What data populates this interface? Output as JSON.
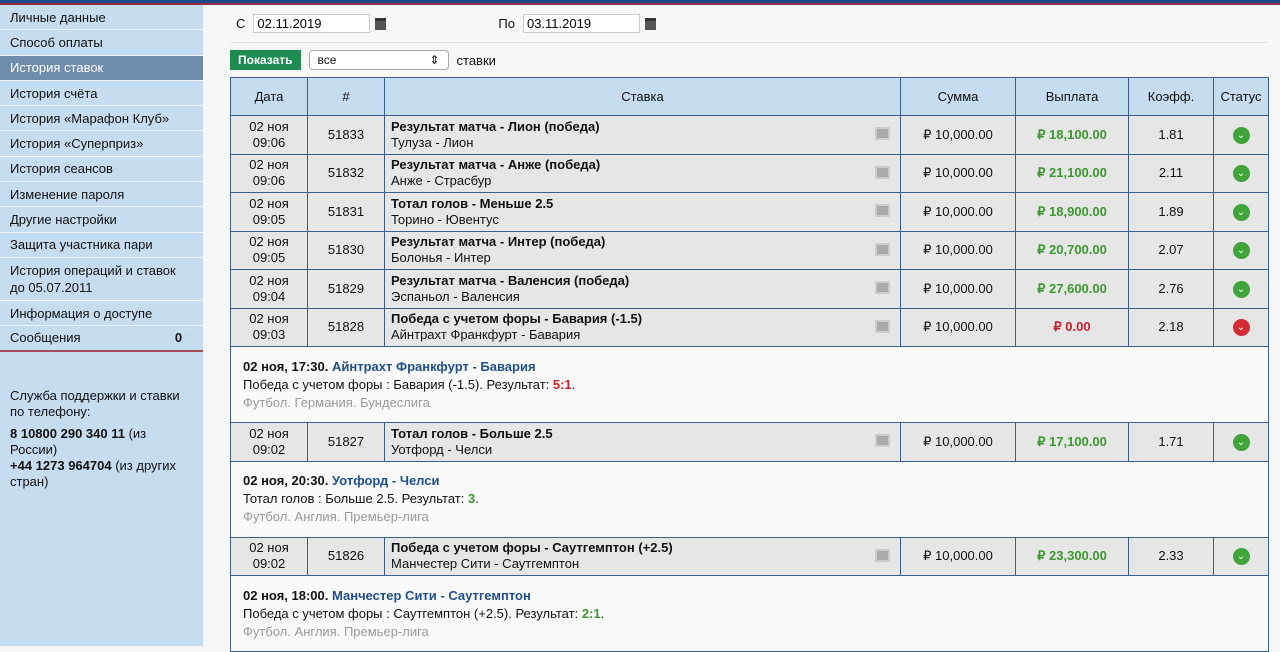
{
  "sidebar": {
    "items": [
      "Личные данные",
      "Способ оплаты",
      "История ставок",
      "История счёта",
      "История «Марафон Клуб»",
      "История «Суперприз»",
      "История сеансов",
      "Изменение пароля",
      "Другие настройки",
      "Защита участника пари",
      "История операций и ставок до 05.07.2011",
      "Информация о доступе",
      "Сообщения"
    ],
    "messages_read": "0",
    "messages_total": "/1",
    "support_title": "Служба поддержки и ставки по телефону:",
    "phone_ru": "8 10800 290 340 11",
    "phone_ru_note": " (из России)",
    "phone_intl": "+44 1273 964704",
    "phone_intl_note": " (из других стран)"
  },
  "filters": {
    "from_label": "С",
    "from": "02.11.2019",
    "to_label": "По",
    "to": "03.11.2019",
    "show": "Показать",
    "type": "все",
    "type_suffix": "ставки"
  },
  "table": {
    "headers": [
      "Дата",
      "#",
      "Ставка",
      "Сумма",
      "Выплата",
      "Коэфф.",
      "Статус"
    ],
    "rows": [
      {
        "date": "02 ноя",
        "time": "09:06",
        "id": "51833",
        "bet": "Результат матча - Лион (победа)",
        "match": "Тулуза - Лион",
        "sum": "₽ 10,000.00",
        "payout": "₽ 18,100.00",
        "odds": "1.81",
        "status": "win"
      },
      {
        "date": "02 ноя",
        "time": "09:06",
        "id": "51832",
        "bet": "Результат матча - Анже (победа)",
        "match": "Анже - Страсбур",
        "sum": "₽ 10,000.00",
        "payout": "₽ 21,100.00",
        "odds": "2.11",
        "status": "win"
      },
      {
        "date": "02 ноя",
        "time": "09:05",
        "id": "51831",
        "bet": "Тотал голов - Меньше 2.5",
        "match": "Торино - Ювентус",
        "sum": "₽ 10,000.00",
        "payout": "₽ 18,900.00",
        "odds": "1.89",
        "status": "win"
      },
      {
        "date": "02 ноя",
        "time": "09:05",
        "id": "51830",
        "bet": "Результат матча - Интер (победа)",
        "match": "Болонья - Интер",
        "sum": "₽ 10,000.00",
        "payout": "₽ 20,700.00",
        "odds": "2.07",
        "status": "win"
      },
      {
        "date": "02 ноя",
        "time": "09:04",
        "id": "51829",
        "bet": "Результат матча - Валенсия (победа)",
        "match": "Эспаньол - Валенсия",
        "sum": "₽ 10,000.00",
        "payout": "₽ 27,600.00",
        "odds": "2.76",
        "status": "win"
      },
      {
        "date": "02 ноя",
        "time": "09:03",
        "id": "51828",
        "bet": "Победа с учетом форы - Бавария (-1.5)",
        "match": "Айнтрахт Франкфурт - Бавария",
        "sum": "₽ 10,000.00",
        "payout": "₽ 0.00",
        "odds": "2.18",
        "status": "lose",
        "detail": {
          "when": "02 ноя, 17:30.",
          "event": "Айнтрахт Франкфурт - Бавария",
          "desc": "Победа с учетом форы : Бавария (-1.5). Результат: ",
          "score": "5:1",
          "league": "Футбол. Германия. Бундеслига"
        }
      },
      {
        "date": "02 ноя",
        "time": "09:02",
        "id": "51827",
        "bet": "Тотал голов - Больше 2.5",
        "match": "Уотфорд - Челси",
        "sum": "₽ 10,000.00",
        "payout": "₽ 17,100.00",
        "odds": "1.71",
        "status": "win",
        "detail": {
          "when": "02 ноя, 20:30.",
          "event": "Уотфорд - Челси",
          "desc": "Тотал голов : Больше 2.5. Результат: ",
          "score": "3",
          "league": "Футбол. Англия. Премьер-лига"
        }
      },
      {
        "date": "02 ноя",
        "time": "09:02",
        "id": "51826",
        "bet": "Победа с учетом форы - Саутгемптон (+2.5)",
        "match": "Манчестер Сити - Саутгемптон",
        "sum": "₽ 10,000.00",
        "payout": "₽ 23,300.00",
        "odds": "2.33",
        "status": "win",
        "detail": {
          "when": "02 ноя, 18:00.",
          "event": "Манчестер Сити - Саутгемптон",
          "desc": "Победа с учетом форы : Саутгемптон (+2.5). Результат: ",
          "score": "2:1",
          "league": "Футбол. Англия. Премьер-лига"
        }
      }
    ]
  }
}
